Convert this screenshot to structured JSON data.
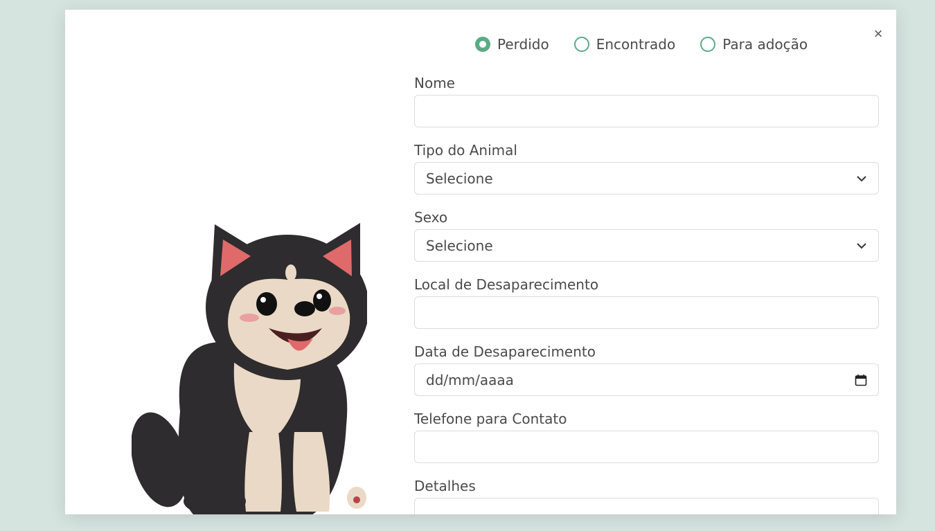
{
  "modal": {
    "close_label": "×",
    "status_options": [
      {
        "label": "Perdido",
        "checked": true
      },
      {
        "label": "Encontrado",
        "checked": false
      },
      {
        "label": "Para adoção",
        "checked": false
      }
    ]
  },
  "form": {
    "nome": {
      "label": "Nome",
      "value": ""
    },
    "tipo_animal": {
      "label": "Tipo do Animal",
      "selected": "Selecione"
    },
    "sexo": {
      "label": "Sexo",
      "selected": "Selecione"
    },
    "local": {
      "label": "Local de Desaparecimento",
      "value": ""
    },
    "data": {
      "label": "Data de Desaparecimento",
      "placeholder": "dd/mm/aaaa"
    },
    "telefone": {
      "label": "Telefone para Contato",
      "value": ""
    },
    "detalhes": {
      "label": "Detalhes",
      "value": ""
    }
  },
  "colors": {
    "accent": "#5aab86",
    "backdrop": "#d6e4e0",
    "text": "#4a4a4a"
  },
  "icons": [
    "close-icon",
    "chevron-down-icon",
    "calendar-icon",
    "dog-illustration"
  ]
}
